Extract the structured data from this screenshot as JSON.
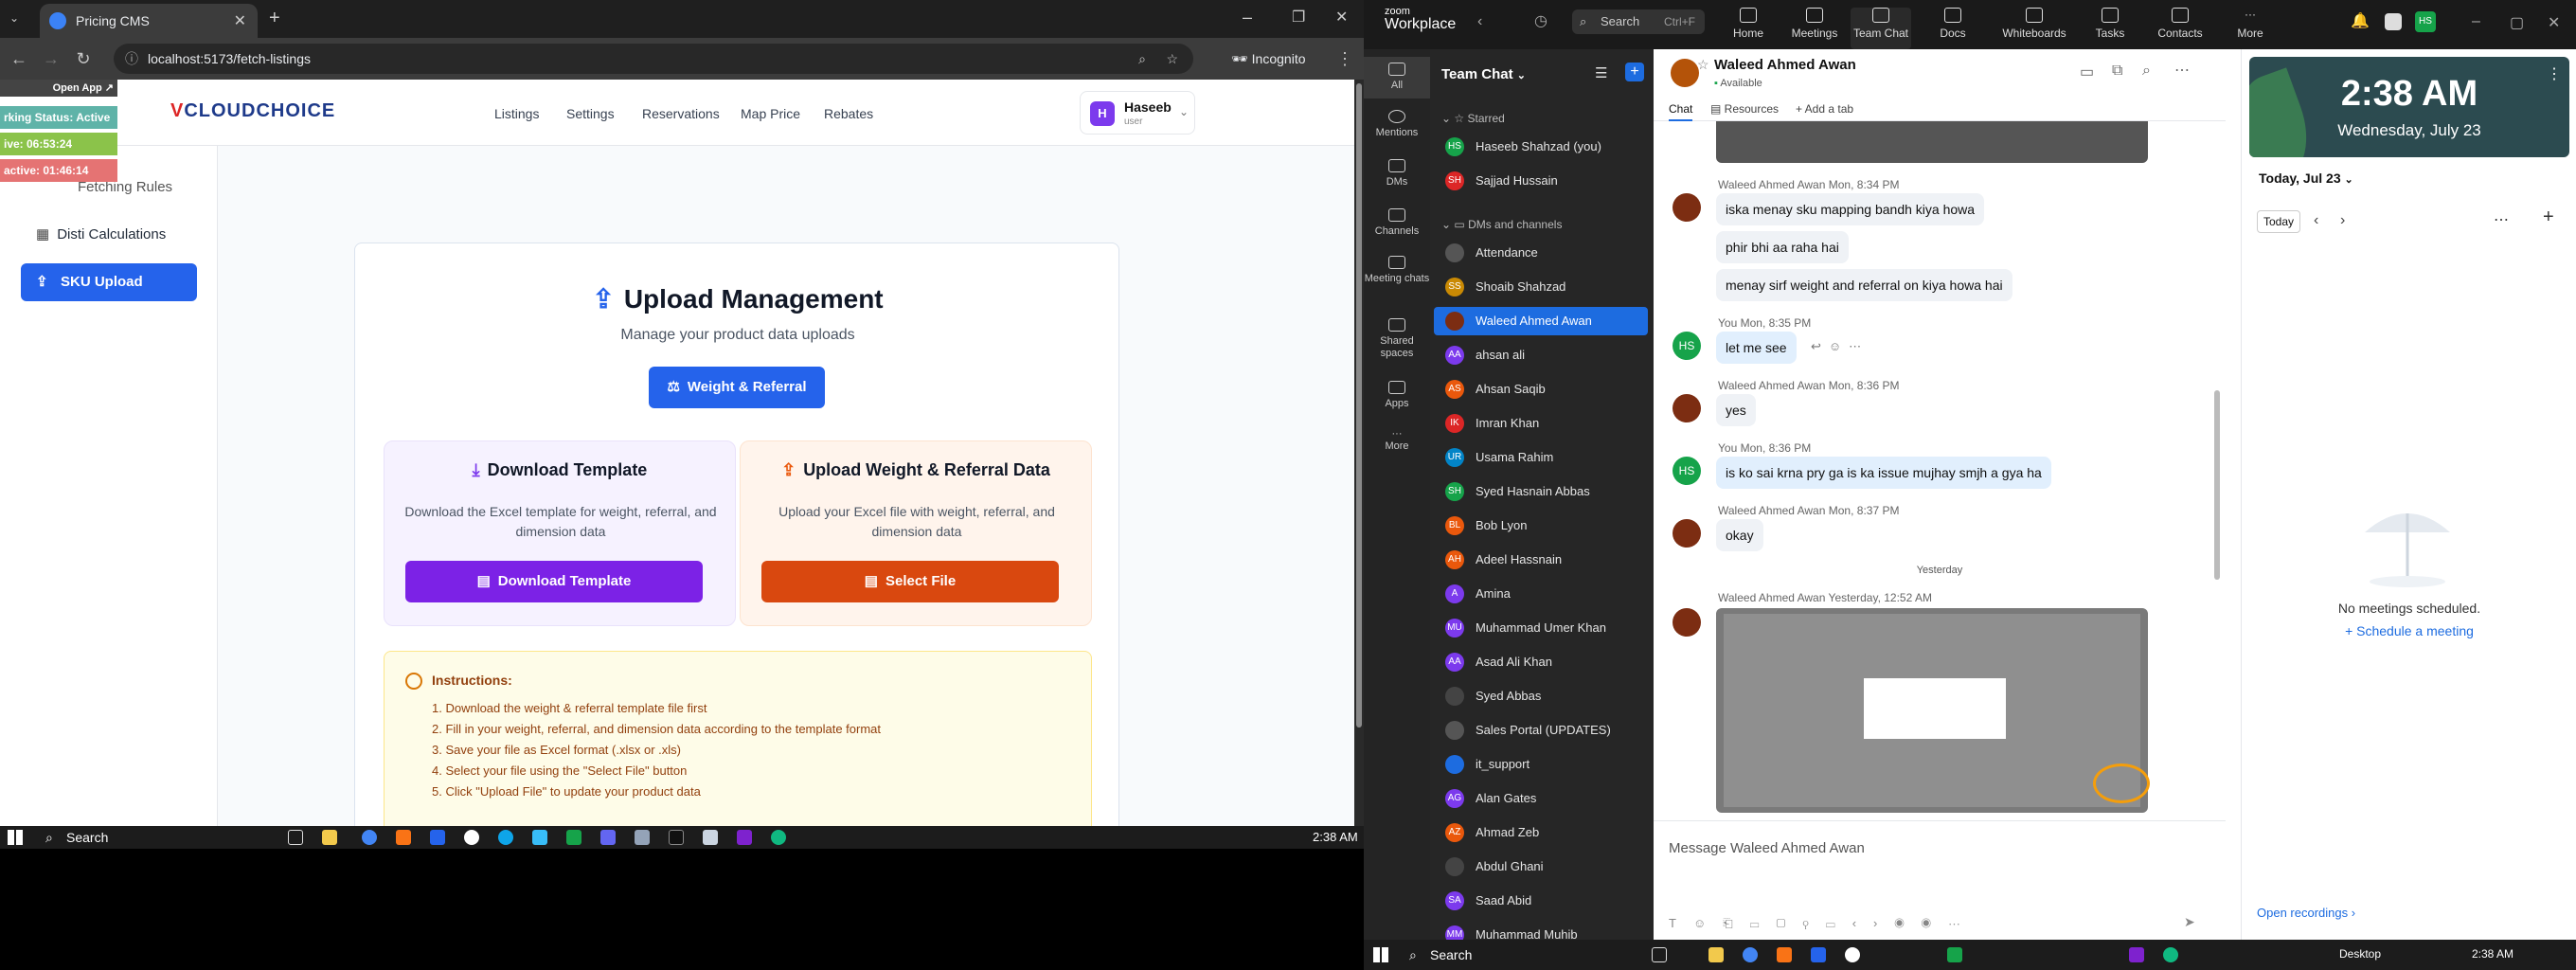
{
  "browser": {
    "tab_title": "Pricing CMS",
    "url": "localhost:5173/fetch-listings",
    "incognito_label": "Incognito"
  },
  "app": {
    "logo_text": "CLOUDCHOICE",
    "nav": [
      "Listings",
      "Settings",
      "Reservations",
      "Map Price",
      "Rebates"
    ],
    "user_name": "Haseeb",
    "user_role": "user",
    "user_initial": "H"
  },
  "overlay": {
    "open_app": "Open App ↗",
    "working_status": "rking Status: Active",
    "active_time": "ive: 06:53:24",
    "inactive_time": "active: 01:46:14"
  },
  "sidebar": {
    "items": [
      "Fetching Rules",
      "Disti Calculations",
      "SKU Upload"
    ]
  },
  "upload": {
    "title": "Upload Management",
    "subtitle": "Manage your product data uploads",
    "weight_button": "Weight & Referral",
    "download": {
      "heading": "Download Template",
      "desc": "Download the Excel template for weight, referral, and dimension data",
      "button": "Download Template"
    },
    "upload_section": {
      "heading": "Upload Weight & Referral Data",
      "desc": "Upload your Excel file with weight, referral, and dimension data",
      "button": "Select File"
    },
    "instructions_title": "Instructions:",
    "instructions": [
      "1. Download the weight & referral template file first",
      "2. Fill in your weight, referral, and dimension data according to the template format",
      "3. Save your file as Excel format (.xlsx or .xls)",
      "4. Select your file using the \"Select File\" button",
      "5. Click \"Upload File\" to update your product data"
    ]
  },
  "taskbar_left": {
    "search": "Search",
    "time": "2:38 AM"
  },
  "zoom": {
    "brand_top": "zoom",
    "brand": "Workplace",
    "search": "Search",
    "search_key": "Ctrl+F",
    "top_nav": [
      "Home",
      "Meetings",
      "Team Chat",
      "Docs",
      "Whiteboards",
      "Tasks",
      "Contacts",
      "More"
    ],
    "user_badge": "HS",
    "rail": [
      "All",
      "Mentions",
      "DMs",
      "Channels",
      "Meeting chats",
      "Shared spaces",
      "Apps",
      "More"
    ],
    "list_title": "Team Chat",
    "starred_label": "Starred",
    "dms_label": "DMs and channels",
    "starred": [
      {
        "name": "Haseeb Shahzad (you)",
        "initials": "HS",
        "color": "#16a34a"
      },
      {
        "name": "Sajjad Hussain",
        "initials": "SH",
        "color": "#dc2626"
      }
    ],
    "contacts": [
      {
        "name": "Attendance",
        "initials": "",
        "color": "#555555"
      },
      {
        "name": "Shoaib Shahzad",
        "initials": "SS",
        "color": "#ca8a04"
      },
      {
        "name": "Waleed Ahmed Awan",
        "initials": "",
        "color": "#7c2d12"
      },
      {
        "name": "ahsan ali",
        "initials": "AA",
        "color": "#7c3aed"
      },
      {
        "name": "Ahsan Saqib",
        "initials": "AS",
        "color": "#ea580c"
      },
      {
        "name": "Imran Khan",
        "initials": "IK",
        "color": "#dc2626"
      },
      {
        "name": "Usama Rahim",
        "initials": "UR",
        "color": "#0284c7"
      },
      {
        "name": "Syed Hasnain Abbas",
        "initials": "SH",
        "color": "#16a34a"
      },
      {
        "name": "Bob Lyon",
        "initials": "BL",
        "color": "#ea580c"
      },
      {
        "name": "Adeel Hassnain",
        "initials": "AH",
        "color": "#ea580c"
      },
      {
        "name": "Amina",
        "initials": "A",
        "color": "#7c3aed"
      },
      {
        "name": "Muhammad Umer Khan",
        "initials": "MU",
        "color": "#7c3aed"
      },
      {
        "name": "Asad Ali Khan",
        "initials": "AA",
        "color": "#7c3aed"
      },
      {
        "name": "Syed Abbas",
        "initials": "",
        "color": "#444444"
      },
      {
        "name": "Sales Portal (UPDATES)",
        "initials": "",
        "color": "#555555"
      },
      {
        "name": "it_support",
        "initials": "",
        "color": "#1d6ce0"
      },
      {
        "name": "Alan Gates",
        "initials": "AG",
        "color": "#7c3aed"
      },
      {
        "name": "Ahmad Zeb",
        "initials": "AZ",
        "color": "#ea580c"
      },
      {
        "name": "Abdul Ghani",
        "initials": "",
        "color": "#444444"
      },
      {
        "name": "Saad Abid",
        "initials": "SA",
        "color": "#7c3aed"
      },
      {
        "name": "Muhammad Muhib",
        "initials": "MM",
        "color": "#7c3aed"
      }
    ],
    "chat": {
      "name": "Waleed Ahmed Awan",
      "status": "Available",
      "tabs": [
        "Chat",
        "Resources",
        "+ Add a tab"
      ],
      "messages": [
        {
          "sender": "Waleed Ahmed Awan",
          "time": "Mon, 8:34 PM",
          "text": "iska menay sku mapping bandh kiya howa"
        },
        {
          "sender": "",
          "time": "",
          "text": "phir bhi aa raha hai"
        },
        {
          "sender": "",
          "time": "",
          "text": "menay sirf weight and referral on kiya howa hai"
        },
        {
          "sender": "You",
          "time": "Mon, 8:35 PM",
          "text": "let me see"
        },
        {
          "sender": "Waleed Ahmed Awan",
          "time": "Mon, 8:36 PM",
          "text": "yes"
        },
        {
          "sender": "You",
          "time": "Mon, 8:36 PM",
          "text": "is ko sai krna pry ga is ka issue mujhay smjh a gya ha"
        },
        {
          "sender": "Waleed Ahmed Awan",
          "time": "Mon, 8:37 PM",
          "text": "okay"
        }
      ],
      "day_separator": "Yesterday",
      "last_sender": "Waleed Ahmed Awan",
      "last_time": "Yesterday, 12:52 AM",
      "composer_placeholder": "Message Waleed Ahmed Awan"
    },
    "side": {
      "time": "2:38 AM",
      "date": "Wednesday, July 23",
      "today_label": "Today, Jul 23",
      "today_button": "Today",
      "no_meetings": "No meetings scheduled.",
      "schedule": "+ Schedule a meeting",
      "open_recordings": "Open recordings ›"
    }
  },
  "taskbar_right": {
    "search": "Search",
    "desktop": "Desktop",
    "time": "2:38 AM"
  }
}
